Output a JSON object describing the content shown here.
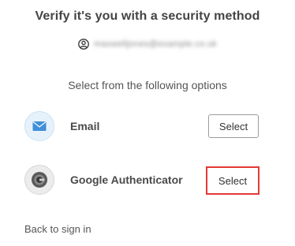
{
  "header": {
    "title": "Verify it's you with a security method",
    "user_identifier": "maxwelljones@example.co.uk"
  },
  "instructions": "Select from the following options",
  "options": [
    {
      "label": "Email",
      "icon": "envelope-icon",
      "button_label": "Select"
    },
    {
      "label": "Google Authenticator",
      "icon": "google-authenticator-icon",
      "button_label": "Select"
    }
  ],
  "footer": {
    "back_link": "Back to sign in"
  },
  "colors": {
    "highlight": "#e53935",
    "email_icon_bg": "#e6f2fb",
    "email_icon": "#3f8fd8"
  }
}
